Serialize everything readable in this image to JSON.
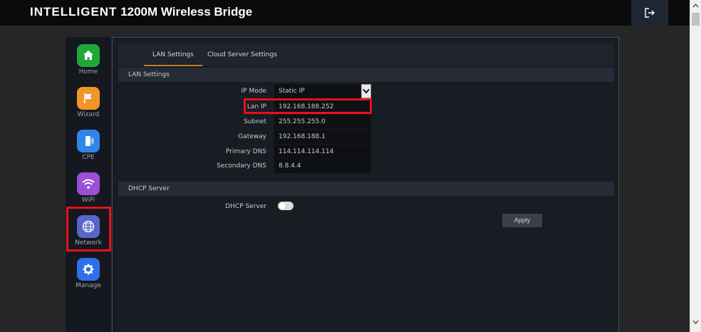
{
  "header": {
    "brand_primary": "INTELLIGENT",
    "brand_secondary": "1200M Wireless Bridge",
    "logout_icon": "logout-icon"
  },
  "sidebar": {
    "items": [
      {
        "label": "Home",
        "icon": "home-icon",
        "color": "#1fa83a"
      },
      {
        "label": "Wizard",
        "icon": "flag-icon",
        "color": "#f0952a"
      },
      {
        "label": "CPE",
        "icon": "cpe-device-icon",
        "color": "#2f86e8"
      },
      {
        "label": "WiFi",
        "icon": "wifi-icon",
        "color": "#9b4fd8"
      },
      {
        "label": "Network",
        "icon": "globe-icon",
        "color": "#5865c9"
      },
      {
        "label": "Manage",
        "icon": "gear-icon",
        "color": "#2f6fe8"
      }
    ]
  },
  "tabs": [
    {
      "label": "LAN Settings",
      "active": true
    },
    {
      "label": "Cloud Server Settings",
      "active": false
    }
  ],
  "lan_section": {
    "title": "LAN Settings",
    "fields": [
      {
        "label": "IP Mode",
        "value": "Static IP"
      },
      {
        "label": "Lan IP",
        "value": "192.168.188.252"
      },
      {
        "label": "Subnet",
        "value": "255.255.255.0"
      },
      {
        "label": "Gateway",
        "value": "192.168.188.1"
      },
      {
        "label": "Primary DNS",
        "value": "114.114.114.114"
      },
      {
        "label": "Secondary DNS",
        "value": "8.8.4.4"
      }
    ]
  },
  "dhcp_section": {
    "title": "DHCP Server",
    "toggle_label": "DHCP Server",
    "toggle_on": false
  },
  "apply_label": "Apply",
  "colors": {
    "highlight": "#e8101a",
    "active_tab_underline": "#c07d2b",
    "panel_border": "#3d4b70"
  }
}
